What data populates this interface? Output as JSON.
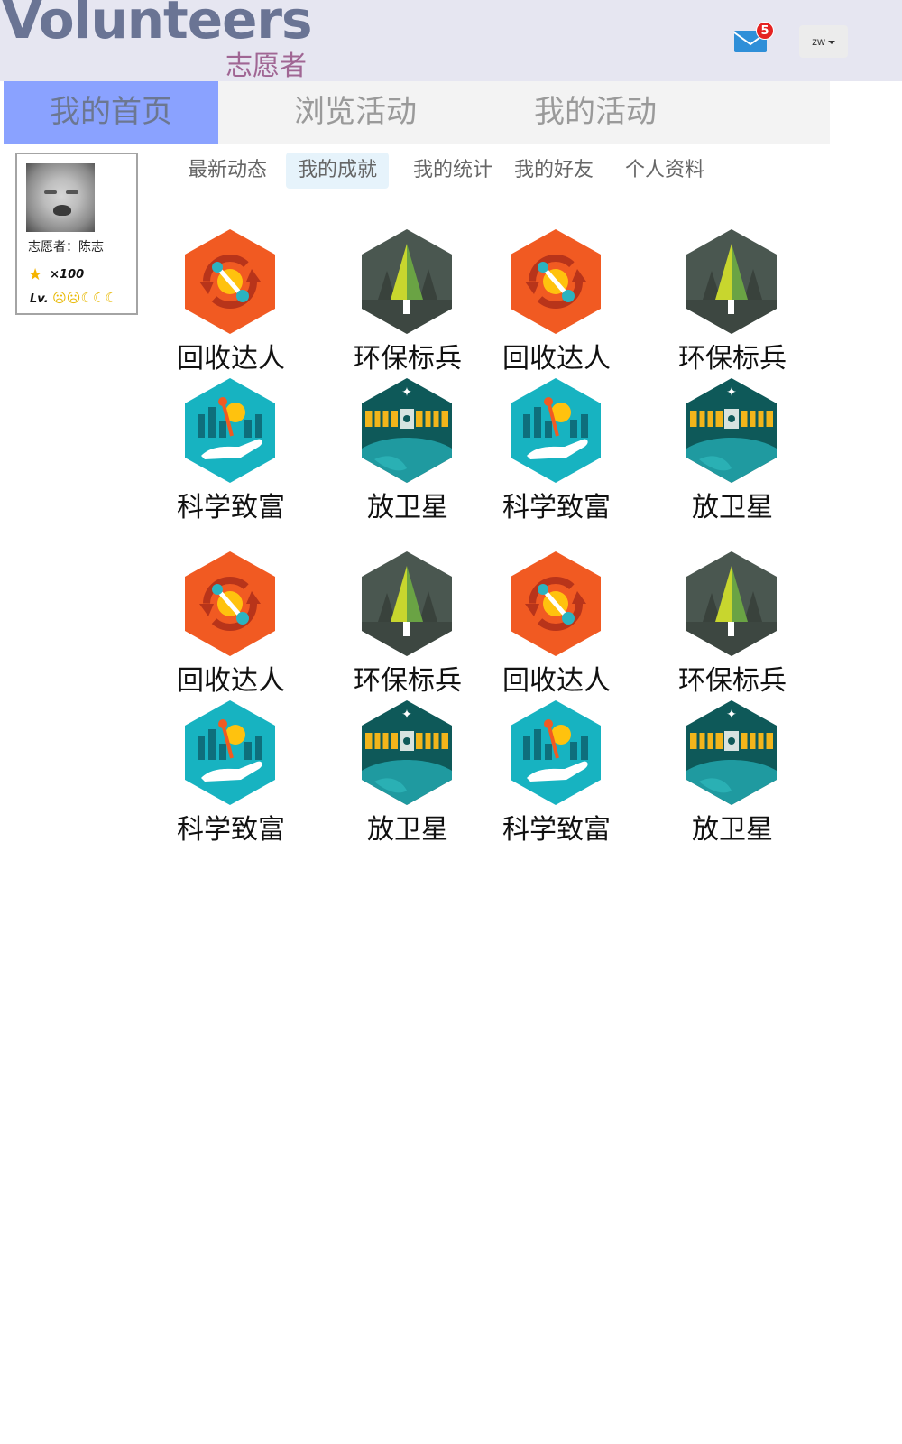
{
  "header": {
    "brand_en": "Volunteers",
    "brand_cn": "志愿者",
    "mail_count": "5",
    "user_menu_label": "zw"
  },
  "main_nav": {
    "tabs": [
      {
        "label": "我的首页",
        "active": true
      },
      {
        "label": "浏览活动",
        "active": false
      },
      {
        "label": "我的活动",
        "active": false
      }
    ]
  },
  "profile": {
    "volunteer_label": "志愿者：陈志",
    "points": "×100",
    "level_label": "Lv."
  },
  "sub_nav": {
    "items": [
      {
        "label": "最新动态",
        "active": false
      },
      {
        "label": "我的成就",
        "active": true
      },
      {
        "label": "我的统计",
        "active": false
      },
      {
        "label": "我的好友",
        "active": false
      },
      {
        "label": "个人资料",
        "active": false
      }
    ]
  },
  "badge_types": {
    "recycle": {
      "name": "回收达人",
      "icon": "recycle-badge-icon",
      "color": "#f15a22"
    },
    "tree": {
      "name": "环保标兵",
      "icon": "tree-badge-icon",
      "color": "#4a5750"
    },
    "science": {
      "name": "科学致富",
      "icon": "science-badge-icon",
      "color": "#17b3c1"
    },
    "satellite": {
      "name": "放卫星",
      "icon": "satellite-badge-icon",
      "color": "#0e5959"
    }
  },
  "achievements": [
    {
      "type": "recycle",
      "name": "回收达人"
    },
    {
      "type": "tree",
      "name": "环保标兵"
    },
    {
      "type": "recycle",
      "name": "回收达人"
    },
    {
      "type": "tree",
      "name": "环保标兵"
    },
    {
      "type": "science",
      "name": "科学致富"
    },
    {
      "type": "satellite",
      "name": "放卫星"
    },
    {
      "type": "science",
      "name": "科学致富"
    },
    {
      "type": "satellite",
      "name": "放卫星"
    },
    {
      "type": "recycle",
      "name": "回收达人"
    },
    {
      "type": "tree",
      "name": "环保标兵"
    },
    {
      "type": "recycle",
      "name": "回收达人"
    },
    {
      "type": "tree",
      "name": "环保标兵"
    },
    {
      "type": "science",
      "name": "科学致富"
    },
    {
      "type": "satellite",
      "name": "放卫星"
    },
    {
      "type": "science",
      "name": "科学致富"
    },
    {
      "type": "satellite",
      "name": "放卫星"
    }
  ]
}
